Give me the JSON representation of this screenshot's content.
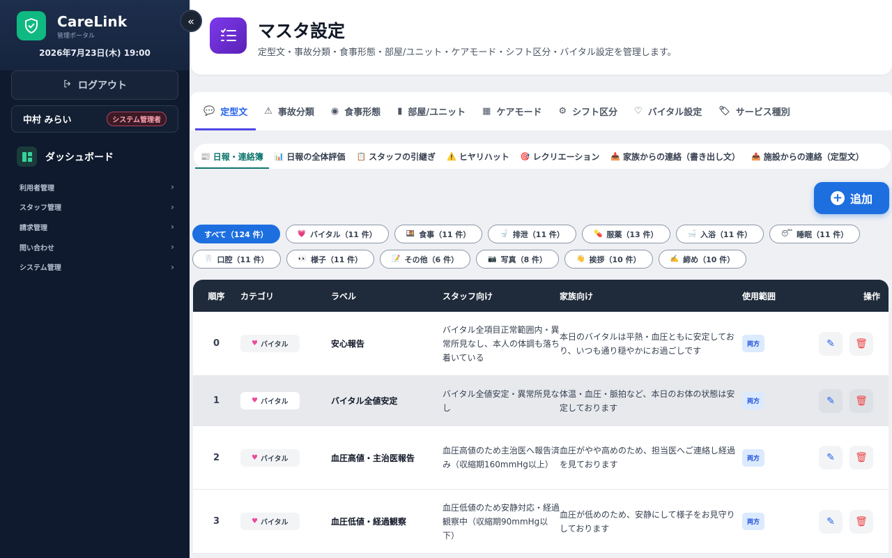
{
  "app": {
    "brand": "CareLink",
    "brand_sub": "管理ポータル",
    "datetime": "2026年7月23日(木) 19:00",
    "logout": "ログアウト",
    "user_name": "中村 みらい",
    "role": "システム管理者",
    "dashboard": "ダッシュボード",
    "nav": [
      "利用者管理",
      "スタッフ管理",
      "請求管理",
      "問い合わせ",
      "システム管理"
    ]
  },
  "header": {
    "title": "マスタ設定",
    "desc": "定型文・事故分類・食事形態・部屋/ユニット・ケアモード・シフト区分・バイタル設定を管理します。"
  },
  "tabs": [
    {
      "label": "定型文",
      "icon": "chat-icon"
    },
    {
      "label": "事故分類",
      "icon": "alert-icon"
    },
    {
      "label": "食事形態",
      "icon": "meal-icon"
    },
    {
      "label": "部屋/ユニット",
      "icon": "door-icon"
    },
    {
      "label": "ケアモード",
      "icon": "grid-icon"
    },
    {
      "label": "シフト区分",
      "icon": "sliders-icon"
    },
    {
      "label": "バイタル設定",
      "icon": "heart-pulse-icon"
    },
    {
      "label": "サービス種別",
      "icon": "tag-icon"
    }
  ],
  "subtabs": [
    {
      "label": "日報・連絡簿",
      "icon": "📰"
    },
    {
      "label": "日報の全体評価",
      "icon": "📊"
    },
    {
      "label": "スタッフの引継ぎ",
      "icon": "📋"
    },
    {
      "label": "ヒヤリハット",
      "icon": "⚠️"
    },
    {
      "label": "レクリエーション",
      "icon": "🎯"
    },
    {
      "label": "家族からの連絡（書き出し文）",
      "icon": "📥"
    },
    {
      "label": "施設からの連絡（定型文）",
      "icon": "📤"
    }
  ],
  "add_label": "追加",
  "chips_row1": [
    {
      "icon": "",
      "label": "すべて（124 件）"
    },
    {
      "icon": "💗",
      "label": "バイタル（11 件）"
    },
    {
      "icon": "🍱",
      "label": "食事（11 件）"
    },
    {
      "icon": "🚽",
      "label": "排泄（11 件）"
    },
    {
      "icon": "💊",
      "label": "服薬（13 件）"
    },
    {
      "icon": "🛁",
      "label": "入浴（11 件）"
    },
    {
      "icon": "😴",
      "label": "睡眠（11 件）"
    }
  ],
  "chips_row2": [
    {
      "icon": "🦷",
      "label": "口腔（11 件）"
    },
    {
      "icon": "👀",
      "label": "様子（11 件）"
    },
    {
      "icon": "📝",
      "label": "その他（6 件）"
    },
    {
      "icon": "📷",
      "label": "写真（8 件）"
    },
    {
      "icon": "👋",
      "label": "挨拶（10 件）"
    },
    {
      "icon": "✍️",
      "label": "締め（10 件）"
    }
  ],
  "table": {
    "headers": {
      "order": "順序",
      "category": "カテゴリ",
      "label": "ラベル",
      "staff": "スタッフ向け",
      "family": "家族向け",
      "scope": "使用範囲",
      "ops": "操作"
    },
    "rows": [
      {
        "order": "0",
        "category": "バイタル",
        "label": "安心報告",
        "staff": "バイタル全項目正常範囲内・異常所見なし、本人の体調も落ち着いている",
        "family": "本日のバイタルは平熱・血圧ともに安定しており、いつも通り穏やかにお過ごしです",
        "scope": "両方"
      },
      {
        "order": "1",
        "category": "バイタル",
        "label": "バイタル全値安定",
        "staff": "バイタル全値安定・異常所見なし",
        "family": "体温・血圧・脈拍など、本日のお体の状態は安定しております",
        "scope": "両方"
      },
      {
        "order": "2",
        "category": "バイタル",
        "label": "血圧高値・主治医報告",
        "staff": "血圧高値のため主治医へ報告済み（収縮期160mmHg以上）",
        "family": "血圧がやや高めのため、担当医へご連絡し経過を見ております",
        "scope": "両方"
      },
      {
        "order": "3",
        "category": "バイタル",
        "label": "血圧低値・経過観察",
        "staff": "血圧低値のため安静対応・経過観察中（収縮期90mmHg以下）",
        "family": "血圧が低めのため、安静にして様子をお見守りしております",
        "scope": "両方"
      }
    ]
  }
}
